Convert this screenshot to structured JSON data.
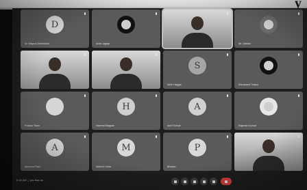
{
  "meeting": {
    "time_label": "8:10 AM",
    "meeting_info": "jas-fbar-kn"
  },
  "participants": [
    {
      "initial": "D",
      "name": "Dr. Mayura Deshmukh",
      "avatar_color": "#d7d7d7",
      "kind": "initial"
    },
    {
      "initial": "",
      "name": "Anita Jagtap",
      "avatar_color": "#111111",
      "kind": "photo"
    },
    {
      "initial": "",
      "name": "",
      "avatar_color": "",
      "kind": "video",
      "active": true
    },
    {
      "initial": "",
      "name": "Mr. Jotiram",
      "avatar_color": "#6a6a6a",
      "kind": "photo"
    },
    {
      "initial": "",
      "name": "",
      "avatar_color": "",
      "kind": "video"
    },
    {
      "initial": "",
      "name": "",
      "avatar_color": "",
      "kind": "video"
    },
    {
      "initial": "S",
      "name": "Sahil Haggal",
      "avatar_color": "#a6a6a6",
      "kind": "initial"
    },
    {
      "initial": "",
      "name": "Shivanand Thakur",
      "avatar_color": "#111111",
      "kind": "photo"
    },
    {
      "initial": "",
      "name": "Prakhar Rane",
      "avatar_color": "#d6d6d6",
      "kind": "blank"
    },
    {
      "initial": "H",
      "name": "Harshad Bagade",
      "avatar_color": "#cfcfcf",
      "kind": "initial"
    },
    {
      "initial": "A",
      "name": "Aarti Shinde",
      "avatar_color": "#d0d0d0",
      "kind": "initial"
    },
    {
      "initial": "",
      "name": "Rajendra Kumar",
      "avatar_color": "#e6e6e6",
      "kind": "photo"
    },
    {
      "initial": "A",
      "name": "Apoorva Patel",
      "avatar_color": "#d4d4d4",
      "kind": "initial"
    },
    {
      "initial": "M",
      "name": "Mahesh Vaira",
      "avatar_color": "#d8d8d8",
      "kind": "initial"
    },
    {
      "initial": "P",
      "name": "Bhuban",
      "avatar_color": "#d8d8d8",
      "kind": "initial"
    },
    {
      "initial": "",
      "name": "",
      "avatar_color": "",
      "kind": "video"
    }
  ],
  "toolbar": {
    "controls": [
      "mic-icon",
      "camera-icon",
      "captions-icon",
      "present-icon",
      "more-icon",
      "end-call-icon"
    ]
  },
  "decor": {
    "paper_text": "y"
  }
}
